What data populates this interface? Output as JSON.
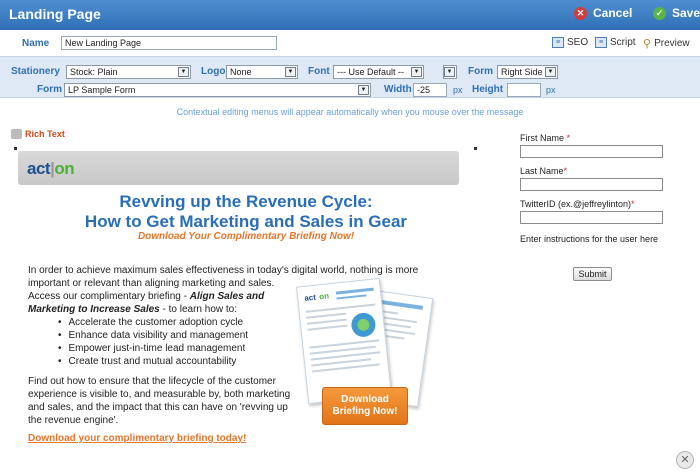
{
  "window": {
    "title": "Landing Page",
    "cancel_label": "Cancel",
    "save_label": "Save"
  },
  "name_row": {
    "label": "Name",
    "value": "New Landing Page",
    "seo_label": "SEO",
    "script_label": "Script",
    "preview_label": "Preview"
  },
  "settings": {
    "stationery_label": "Stationery",
    "stationery_value": "Stock: Plain",
    "logo_label": "Logo",
    "logo_value": "None",
    "font_label": "Font",
    "font_value": "--- Use Default --",
    "form_pos_label": "Form",
    "form_pos_value": "Right Side",
    "form_label": "Form",
    "form_value": "LP Sample Form",
    "width_label": "Width",
    "width_value": "-25",
    "width_unit": "px",
    "height_label": "Height",
    "height_value": "",
    "height_unit": "px"
  },
  "hint": "Contextual editing menus will appear automatically when you mouse over the message",
  "rich_text_label": "Rich Text",
  "content": {
    "logo_text": "act",
    "logo_text_on": "on",
    "headline_1": "Revving up the Revenue Cycle:",
    "headline_2": "How to Get Marketing and Sales in Gear",
    "subhead": "Download Your Complimentary Briefing Now!",
    "para1_line1": "In order to achieve maximum sales effectiveness in today's digital world, nothing is more",
    "para1_line2": "important or relevant than aligning marketing and sales.",
    "para1_line3a": "Access our complimentary briefing - ",
    "para1_line3b": "Align Sales and",
    "para1_line4a": "Marketing to Increase Sales",
    "para1_line4b": " - to learn how to:",
    "bullets": [
      "Accelerate the customer adoption cycle",
      "Enhance data visibility and management",
      "Empower just-in-time lead management",
      "Create trust and mutual accountability"
    ],
    "para2_line1": "Find out how to ensure that the lifecycle of the customer",
    "para2_line2": "experience is visible to, and measurable by, both marketing",
    "para2_line3": "and sales, and the impact that this can have on 'revving up",
    "para2_line4": "the revenue engine'.",
    "cta_link": "Download your complimentary briefing today!",
    "download_button_1": "Download",
    "download_button_2": "Briefing Now!"
  },
  "form": {
    "first_name_label": "First Name",
    "last_name_label": "Last Name",
    "twitter_label": "TwitterID (ex.@jeffreylinton)",
    "required_mark": "*",
    "instructions": "Enter instructions for the user here",
    "submit_label": "Submit"
  },
  "colors": {
    "title_bar": "#2f6fb6",
    "accent_orange": "#e8752a",
    "headline_blue": "#2a6eb8",
    "settings_bg": "#dfe9f5"
  }
}
